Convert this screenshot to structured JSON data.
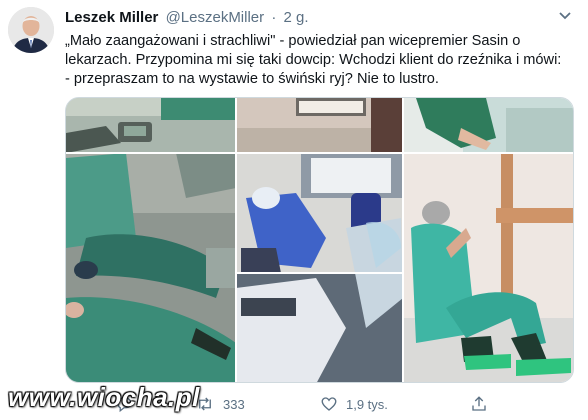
{
  "tweet": {
    "author_name": "Leszek Miller",
    "author_handle": "@LeszekMiller",
    "separator": "·",
    "age": "2 g.",
    "text_lines": [
      "„Mało zaangażowani i strachliwi\" - powiedział pan wicepremier Sasin o",
      "lekarzach. Przypomina mi się taki dowcip: Wchodzi klient do rzeźnika i mówi:",
      "- przepraszam to na wystawie to świński ryj? Nie to lustro."
    ]
  },
  "actions": {
    "reply_icon": "reply-icon",
    "retweet_icon": "retweet-icon",
    "retweet_count": "333",
    "like_icon": "heart-icon",
    "like_count": "1,9 tys.",
    "share_icon": "share-icon"
  },
  "watermark": "www.wiocha.pl",
  "colors": {
    "text": "#0f1419",
    "secondary": "#5b7083",
    "scrub_green": "#2e8a73",
    "scrub_teal": "#3fb6a4",
    "ppe_blue": "#3f63c8"
  }
}
